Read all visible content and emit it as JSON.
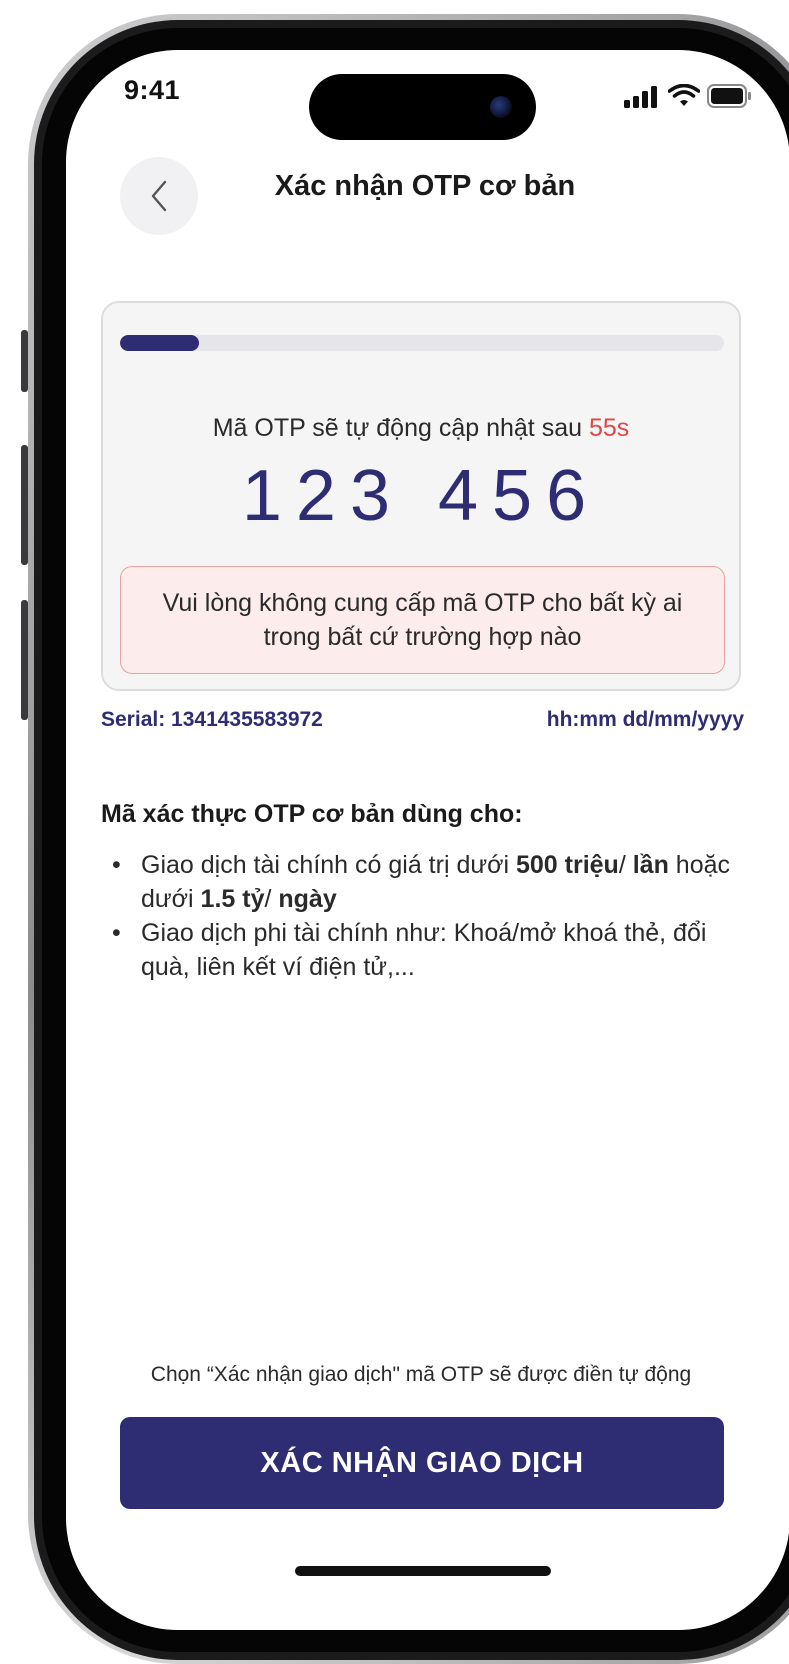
{
  "status_bar": {
    "time": "9:41"
  },
  "header": {
    "title": "Xác nhận OTP cơ bản"
  },
  "otp": {
    "progress": 0.13,
    "note_prefix": "Mã OTP sẽ tự động cập nhật sau ",
    "note_seconds": "55s",
    "code": "123 456",
    "warning": "Vui lòng không cung cấp mã OTP cho bất kỳ ai trong bất cứ trường hợp nào"
  },
  "meta": {
    "serial": "Serial: 1341435583972",
    "datetime": "hh:mm dd/mm/yyyy"
  },
  "uses": {
    "title": "Mã xác thực OTP cơ bản dùng cho:",
    "item1": {
      "t1": "Giao dịch tài chính có giá trị dưới ",
      "b1": "500 triệu",
      "t2": "/ ",
      "b2": "lần",
      "t3": " hoặc dưới ",
      "b3": "1.5 tỷ",
      "t4": "/ ",
      "b4": "ngày"
    },
    "item2": "Giao dịch phi tài chính như: Khoá/mở khoá thẻ, đổi quà, liên kết ví điện tử,..."
  },
  "footer": {
    "hint": "Chọn “Xác nhận giao dịch\" mã OTP sẽ được điền tự động",
    "confirm_label": "XÁC NHẬN GIAO DỊCH"
  },
  "colors": {
    "brand": "#2e2c72",
    "countdown": "#e04646",
    "warning_bg": "#fcecec",
    "warning_border": "#e7a3a3"
  }
}
